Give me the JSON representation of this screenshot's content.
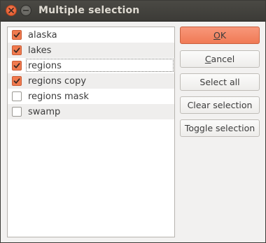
{
  "window": {
    "title": "Multiple selection"
  },
  "list": {
    "items": [
      {
        "label": "alaska",
        "checked": true
      },
      {
        "label": "lakes",
        "checked": true
      },
      {
        "label": "regions",
        "checked": true
      },
      {
        "label": "regions copy",
        "checked": true
      },
      {
        "label": "regions mask",
        "checked": false
      },
      {
        "label": "swamp",
        "checked": false
      }
    ]
  },
  "buttons": {
    "ok": {
      "mnemonic": "O",
      "rest": "K"
    },
    "cancel": {
      "mnemonic": "C",
      "rest": "ancel"
    },
    "select_all": "Select all",
    "clear_selection": "Clear selection",
    "toggle_selection": "Toggle selection"
  },
  "colors": {
    "accent": "#f07a4e",
    "titlebar": "#3c3b37"
  }
}
